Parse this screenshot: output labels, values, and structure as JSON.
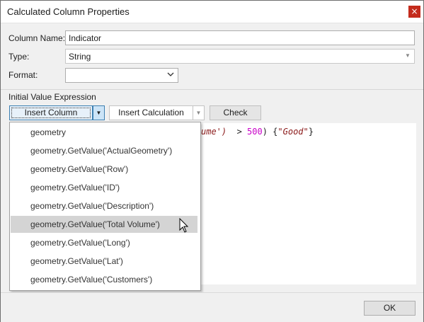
{
  "window": {
    "title": "Calculated Column Properties",
    "close_glyph": "×"
  },
  "form": {
    "column_name_label": "Column Name:",
    "column_name_value": "Indicator",
    "type_label": "Type:",
    "type_value": "String",
    "format_label": "Format:",
    "format_value": ""
  },
  "expression": {
    "section_label": "Initial Value Expression",
    "insert_column_label": "Insert Column",
    "insert_calculation_label": "Insert Calculation",
    "check_label": "Check",
    "code_part1": "ume')",
    "code_part2": "  > ",
    "code_number": "500",
    "code_part3": ") {",
    "code_string": "\"Good\"",
    "code_part4": "}"
  },
  "dropdown": {
    "items": [
      "geometry",
      "geometry.GetValue('ActualGeometry')",
      "geometry.GetValue('Row')",
      "geometry.GetValue('ID')",
      "geometry.GetValue('Description')",
      "geometry.GetValue('Total Volume')",
      "geometry.GetValue('Long')",
      "geometry.GetValue('Lat')",
      "geometry.GetValue('Customers')"
    ],
    "highlighted_index": 5
  },
  "footer": {
    "ok_label": "OK"
  },
  "colors": {
    "accent": "#3c7fb1",
    "close_red": "#c42b1c",
    "code_number": "#c800c8",
    "code_string": "#8b1a1a"
  },
  "icons": [
    "close-icon",
    "chevron-down-icon",
    "mouse-cursor-icon"
  ]
}
